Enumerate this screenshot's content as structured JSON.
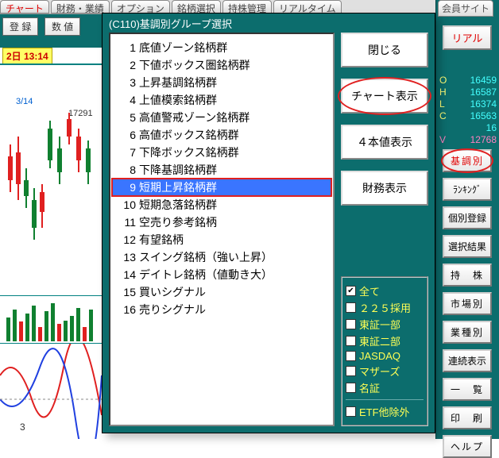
{
  "bg_tabs": [
    "チャート",
    "財務・業績",
    "オプション",
    "銘柄選択",
    "持株管理",
    "リアルタイム",
    "会員サイト"
  ],
  "bg_tabs_active": 0,
  "toolbar": {
    "register": "登 録",
    "numeric": "数 値"
  },
  "timestamp": "2日 13:14",
  "chart_hint_date": "3/14",
  "chart_hint_val": "17291",
  "bottom_index": "3",
  "dialog": {
    "title": "(C110)基調別グループ選択",
    "items": [
      {
        "n": 1,
        "label": "底値ゾーン銘柄群"
      },
      {
        "n": 2,
        "label": "下値ボックス圏銘柄群"
      },
      {
        "n": 3,
        "label": "上昇基調銘柄群"
      },
      {
        "n": 4,
        "label": "上値模索銘柄群"
      },
      {
        "n": 5,
        "label": "高値警戒ゾーン銘柄群"
      },
      {
        "n": 6,
        "label": "高値ボックス銘柄群"
      },
      {
        "n": 7,
        "label": "下降ボックス銘柄群"
      },
      {
        "n": 8,
        "label": "下降基調銘柄群"
      },
      {
        "n": 9,
        "label": "短期上昇銘柄群"
      },
      {
        "n": 10,
        "label": "短期急落銘柄群"
      },
      {
        "n": 11,
        "label": "空売り参考銘柄"
      },
      {
        "n": 12,
        "label": "有望銘柄"
      },
      {
        "n": 13,
        "label": "スイング銘柄（強い上昇）"
      },
      {
        "n": 14,
        "label": "デイトレ銘柄（値動き大）"
      },
      {
        "n": 15,
        "label": "買いシグナル"
      },
      {
        "n": 16,
        "label": "売りシグナル"
      }
    ],
    "selected": 9,
    "buttons": {
      "close": "閉じる",
      "chart": "チャート表示",
      "ohlc": "４本値表示",
      "fin": "財務表示"
    },
    "filters": [
      {
        "label": "全て",
        "checked": true
      },
      {
        "label": "２２５採用",
        "checked": false
      },
      {
        "label": "東証一部",
        "checked": false
      },
      {
        "label": "東証二部",
        "checked": false
      },
      {
        "label": "JASDAQ",
        "checked": false
      },
      {
        "label": "マザーズ",
        "checked": false
      },
      {
        "label": "名証",
        "checked": false
      }
    ],
    "filter_extra": {
      "label": "ETF他除外",
      "checked": false
    }
  },
  "right": {
    "top_tab": "会員サイト",
    "real": "リアル",
    "stats": [
      {
        "k": "O",
        "v": "16459"
      },
      {
        "k": "H",
        "v": "16587"
      },
      {
        "k": "L",
        "v": "16374"
      },
      {
        "k": "C",
        "v": "16563"
      },
      {
        "k": "",
        "v": "16"
      },
      {
        "k": "V",
        "v": "12768"
      }
    ],
    "buttons": [
      "基調別",
      "ﾗﾝｷﾝｸﾞ",
      "個別登録",
      "選択結果",
      "持　株",
      "市場別",
      "業種別",
      "連続表示",
      "一　覧",
      "印　刷",
      "ヘルプ"
    ],
    "highlight_idx": 0
  },
  "chart_data": {
    "type": "bar",
    "note": "approximate decorative candlestick background; values not legibly readable from crop",
    "categories": [],
    "values": []
  }
}
